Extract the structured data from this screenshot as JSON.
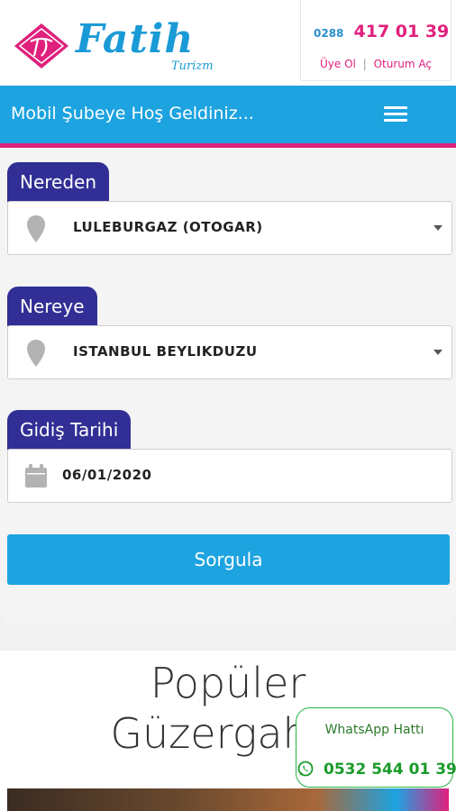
{
  "header": {
    "logo_name": "Fatih",
    "logo_sub": "Turizm",
    "phone_prefix": "0288",
    "phone_number": "417 01 39",
    "signup_label": "Üye Ol",
    "separator": "|",
    "login_label": "Oturum Aç"
  },
  "navbar": {
    "title": "Mobil Şubeye Hoş Geldiniz...",
    "menu_icon": "hamburger-icon"
  },
  "search_form": {
    "from": {
      "label": "Nereden",
      "value": "LULEBURGAZ (OTOGAR)",
      "icon": "map-pin-icon"
    },
    "to": {
      "label": "Nereye",
      "value": "ISTANBUL BEYLIKDUZU",
      "icon": "map-pin-icon"
    },
    "date": {
      "label": "Gidiş Tarihi",
      "value": "06/01/2020",
      "icon": "calendar-icon"
    },
    "submit_label": "Sorgula"
  },
  "popular_routes": {
    "title_line1": "Popüler",
    "title_line2": "Güzergahla"
  },
  "whatsapp": {
    "title": "WhatsApp Hattı",
    "phone": "0532 544 01 39",
    "icon": "whatsapp-icon"
  },
  "colors": {
    "primary_blue": "#1da3e0",
    "brand_pink": "#e0207d",
    "label_purple": "#312f95",
    "whatsapp_green": "#1b9b2c"
  }
}
